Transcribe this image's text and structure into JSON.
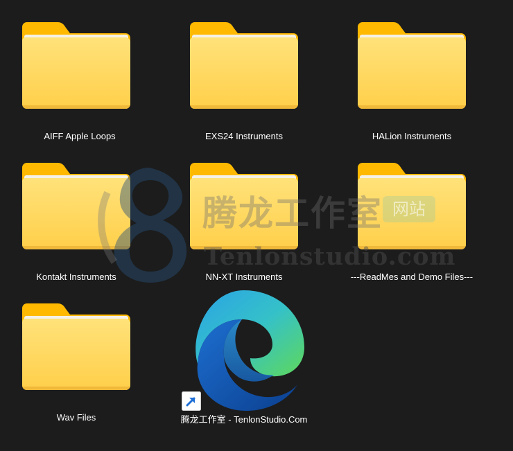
{
  "desktop": {
    "items": [
      {
        "label": "AIFF Apple Loops",
        "icon": "folder-icon"
      },
      {
        "label": "EXS24 Instruments",
        "icon": "folder-icon"
      },
      {
        "label": "HALion Instruments",
        "icon": "folder-icon"
      },
      {
        "label": "Kontakt Instruments",
        "icon": "folder-icon"
      },
      {
        "label": "NN-XT Instruments",
        "icon": "folder-icon"
      },
      {
        "label": "---ReadMes and Demo Files---",
        "icon": "folder-icon"
      },
      {
        "label": "Wav Files",
        "icon": "folder-icon"
      },
      {
        "label": "腾龙工作室 - TenlonStudio.Com",
        "icon": "edge-shortcut-icon"
      }
    ]
  },
  "watermark": {
    "cn": "腾龙工作室",
    "badge": "网站",
    "en": "Tenlonstudio.com"
  },
  "colors": {
    "background": "#1c1c1c",
    "folder_front": "#ffd45c",
    "folder_back": "#ffb900"
  }
}
